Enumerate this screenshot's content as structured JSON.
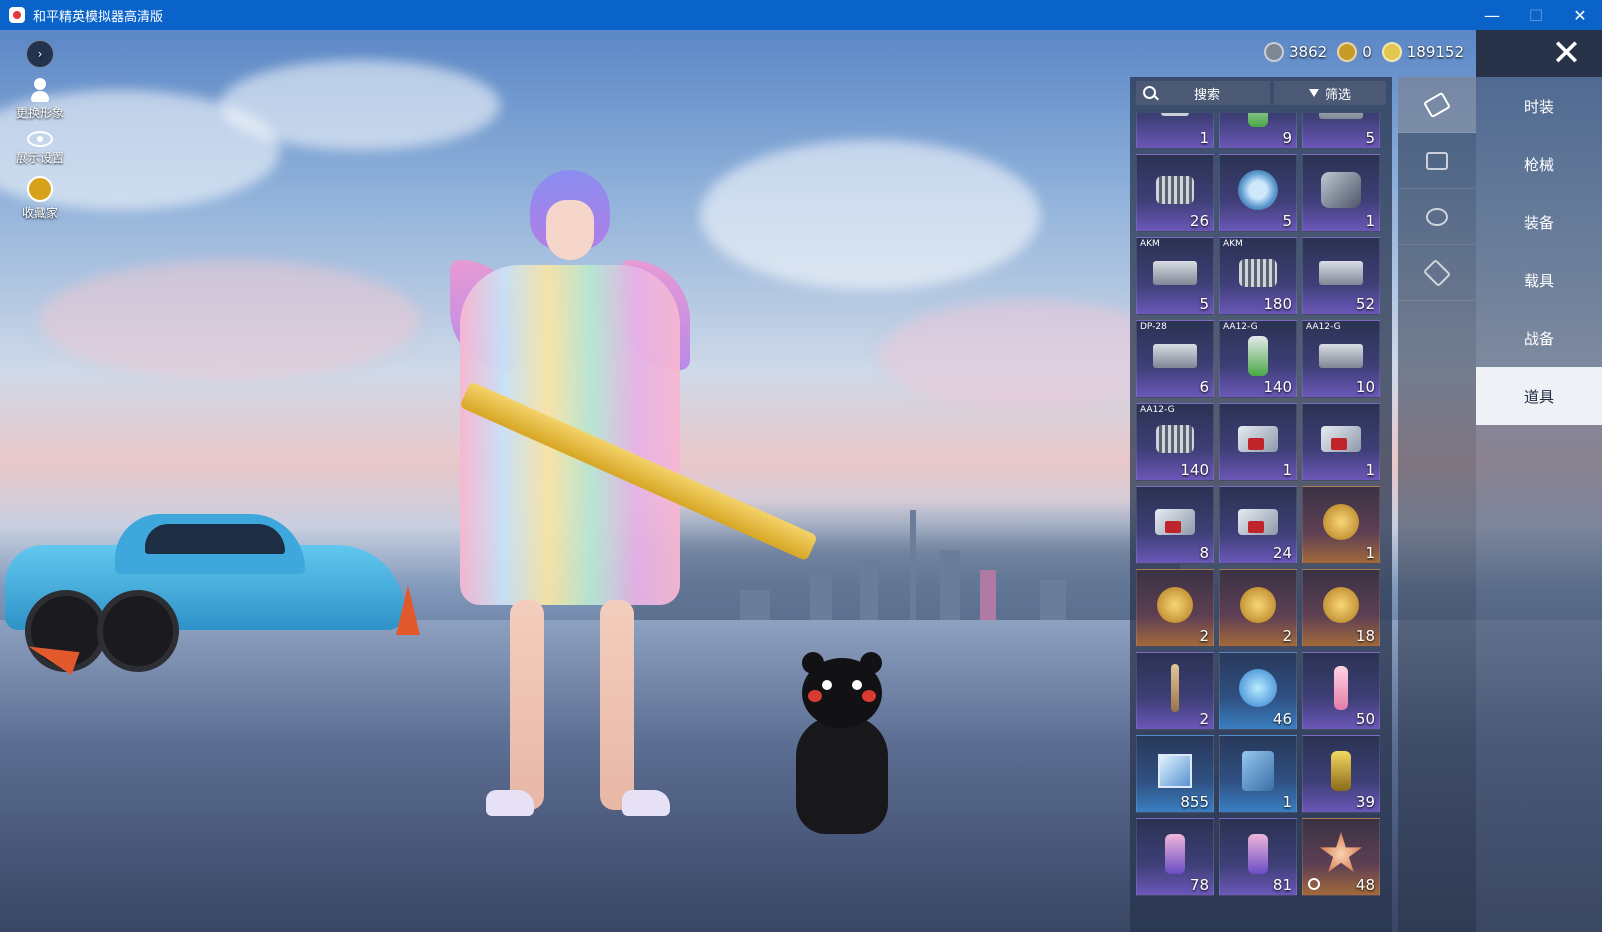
{
  "window": {
    "title": "和平精英模拟器高清版",
    "minimize": "—",
    "maximize": "☐",
    "close": "✕"
  },
  "side_tools": [
    {
      "label": "更换形象"
    },
    {
      "label": "展示设置"
    },
    {
      "label": "收藏家"
    }
  ],
  "currency": [
    {
      "value": "3862",
      "color": "#7d8796"
    },
    {
      "value": "0",
      "color": "#c89a26"
    },
    {
      "value": "189152",
      "color": "#e2c74c"
    }
  ],
  "search": {
    "label": "搜索"
  },
  "filter": {
    "label": "筛选"
  },
  "nav": [
    {
      "label": "时装",
      "active": false
    },
    {
      "label": "枪械",
      "active": false
    },
    {
      "label": "装备",
      "active": false
    },
    {
      "label": "载具",
      "active": false
    },
    {
      "label": "战备",
      "active": false
    },
    {
      "label": "道具",
      "active": true
    }
  ],
  "categories": [
    "card-icon",
    "box-icon",
    "burst-icon",
    "ticket-icon"
  ],
  "inventory": [
    {
      "tag": "",
      "qty": "1",
      "icon": "wrench-icon"
    },
    {
      "tag": "",
      "qty": "9",
      "icon": "capsule-icon"
    },
    {
      "tag": "",
      "qty": "5",
      "icon": "crate-icon"
    },
    {
      "tag": "",
      "qty": "26",
      "icon": "spring-icon"
    },
    {
      "tag": "",
      "qty": "5",
      "icon": "disc-icon"
    },
    {
      "tag": "",
      "qty": "1",
      "icon": "parts-icon"
    },
    {
      "tag": "AKM",
      "qty": "5",
      "icon": "crate-icon"
    },
    {
      "tag": "AKM",
      "qty": "180",
      "icon": "spring-icon"
    },
    {
      "tag": "",
      "qty": "52",
      "icon": "tray-icon"
    },
    {
      "tag": "DP-28",
      "qty": "6",
      "icon": "tray-icon"
    },
    {
      "tag": "AA12-G",
      "qty": "140",
      "icon": "spray-can-icon"
    },
    {
      "tag": "AA12-G",
      "qty": "10",
      "icon": "tray-icon"
    },
    {
      "tag": "AA12-G",
      "qty": "140",
      "icon": "spring-icon"
    },
    {
      "tag": "",
      "qty": "1",
      "icon": "exp-card-1day-icon"
    },
    {
      "tag": "",
      "qty": "1",
      "icon": "exp-card-3day-icon"
    },
    {
      "tag": "",
      "qty": "8",
      "icon": "exp-card-3day-icon"
    },
    {
      "tag": "",
      "qty": "24",
      "icon": "exp-card-2hour-icon"
    },
    {
      "tag": "",
      "qty": "1",
      "icon": "gold-card-3day-icon"
    },
    {
      "tag": "",
      "qty": "2",
      "icon": "gold-card-1day-icon"
    },
    {
      "tag": "",
      "qty": "2",
      "icon": "gold-card-3day-icon"
    },
    {
      "tag": "",
      "qty": "18",
      "icon": "gold-card-2hour-icon"
    },
    {
      "tag": "",
      "qty": "2",
      "icon": "bat-icon"
    },
    {
      "tag": "",
      "qty": "46",
      "icon": "puzzle-orb-icon"
    },
    {
      "tag": "",
      "qty": "50",
      "icon": "glowsticks-icon"
    },
    {
      "tag": "",
      "qty": "855",
      "icon": "diamond-icon"
    },
    {
      "tag": "",
      "qty": "1",
      "icon": "book-icon"
    },
    {
      "tag": "",
      "qty": "39",
      "icon": "grenade-icon"
    },
    {
      "tag": "",
      "qty": "78",
      "icon": "spray-paint-icon"
    },
    {
      "tag": "",
      "qty": "81",
      "icon": "paint-gun-icon"
    },
    {
      "tag": "",
      "qty": "48",
      "icon": "star-badge-icon"
    }
  ]
}
